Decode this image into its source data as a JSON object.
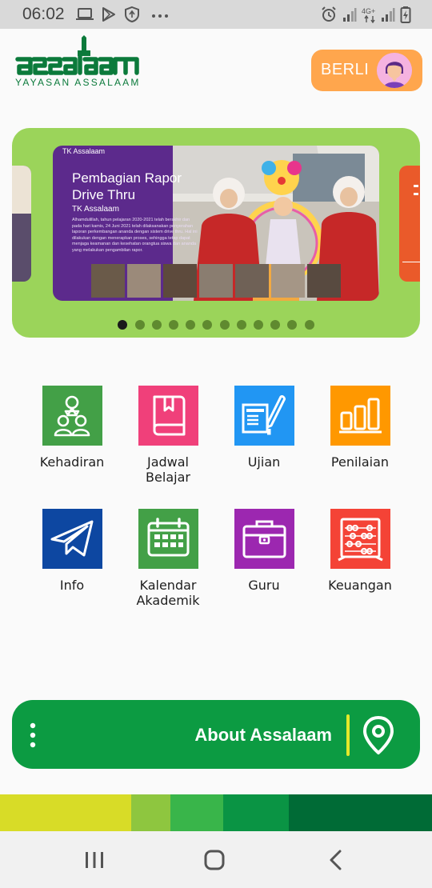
{
  "status_bar": {
    "time": "06:02",
    "network": "4G+",
    "left_icons": [
      "laptop-icon",
      "play-store-icon",
      "shield-icon",
      "more-dots-icon"
    ],
    "right_icons": [
      "alarm-icon",
      "signal-icon",
      "signal-icon",
      "battery-icon"
    ]
  },
  "header": {
    "logo_mark": "assalaam",
    "logo_tagline": "YAYASAN ASSALAAM",
    "language_button": "BERLI",
    "avatar": "user-avatar-icon"
  },
  "banner": {
    "slide": {
      "tag": "TK Assalaam",
      "title": "Pembagian Rapor Drive Thru",
      "subtitle": "TK Assalaam",
      "body": "Alhamdulillah, tahun pelajaran 2020-2021 telah berakhir dan pada hari kamis, 24 Juni 2021 telah dilaksanakan penyerahan laporan perkembangan ananda dengan sistem drive thru. Hal ini dilakukan dengan menerapkan proses, sehingga tetap dapat menjaga keamanan dan kesehatan orangtua siswa dan ananda yang melakukan pengambilan rapor."
    },
    "slide_count": 12,
    "active_index": 0
  },
  "menu": [
    {
      "label": "Kehadiran",
      "icon": "attendance-icon",
      "color": "#43a047"
    },
    {
      "label": "Jadwal\nBelajar",
      "icon": "book-icon",
      "color": "#f0407a"
    },
    {
      "label": "Ujian",
      "icon": "exam-icon",
      "color": "#2196f3"
    },
    {
      "label": "Penilaian",
      "icon": "bar-chart-icon",
      "color": "#ff9800"
    },
    {
      "label": "Info",
      "icon": "paper-plane-icon",
      "color": "#0d47a1"
    },
    {
      "label": "Kalendar\nAkademik",
      "icon": "calendar-icon",
      "color": "#43a047"
    },
    {
      "label": "Guru",
      "icon": "briefcase-icon",
      "color": "#9c27b0"
    },
    {
      "label": "Keuangan",
      "icon": "abacus-icon",
      "color": "#f44336"
    }
  ],
  "about": {
    "label": "About Assalaam",
    "menu_icon": "kebab-menu-icon",
    "location_icon": "location-pin-icon"
  },
  "footer_stripes": [
    "#d8dc27",
    "#8ec63f",
    "#39b54a",
    "#0a9444",
    "#006b36"
  ],
  "nav_bar": [
    "recent-apps-icon",
    "home-icon",
    "back-icon"
  ]
}
